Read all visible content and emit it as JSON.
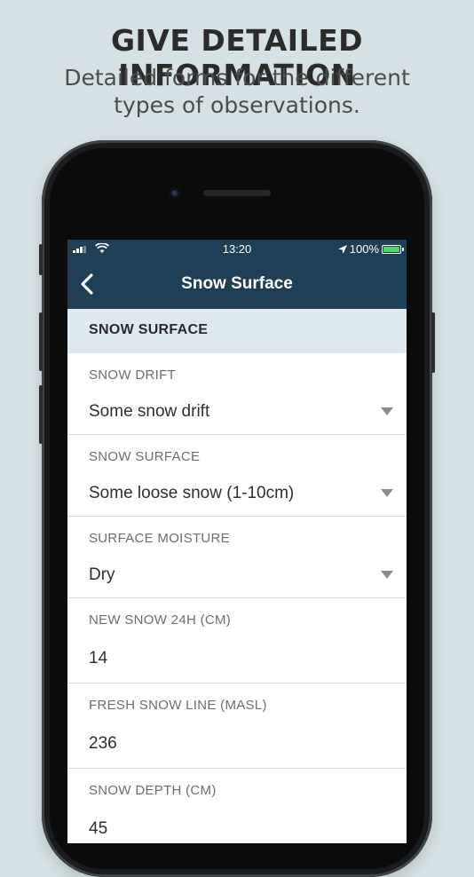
{
  "promo": {
    "title": "GIVE DETAILED INFORMATION",
    "subtitle": "Detailed forms for the different types of observations."
  },
  "status_bar": {
    "time": "13:20",
    "battery": "100%",
    "icons": [
      "signal-icon",
      "wifi-icon",
      "location-arrow-icon",
      "battery-icon"
    ]
  },
  "nav": {
    "title": "Snow Surface",
    "back_icon": "chevron-left-icon"
  },
  "form": {
    "section_title": "SNOW SURFACE",
    "fields": [
      {
        "label": "SNOW DRIFT",
        "value": "Some snow drift",
        "type": "select"
      },
      {
        "label": "SNOW SURFACE",
        "value": "Some loose snow (1-10cm)",
        "type": "select"
      },
      {
        "label": "SURFACE MOISTURE",
        "value": "Dry",
        "type": "select"
      },
      {
        "label": "NEW SNOW 24H (CM)",
        "value": "14",
        "type": "number"
      },
      {
        "label": "FRESH SNOW LINE (MASL)",
        "value": "236",
        "type": "number"
      },
      {
        "label": "SNOW DEPTH (CM)",
        "value": "45",
        "type": "number"
      }
    ]
  },
  "colors": {
    "background": "#d5e1e4",
    "navbar": "#1e3f55",
    "section_header": "#dde8ef",
    "battery_fill": "#4cd964"
  }
}
